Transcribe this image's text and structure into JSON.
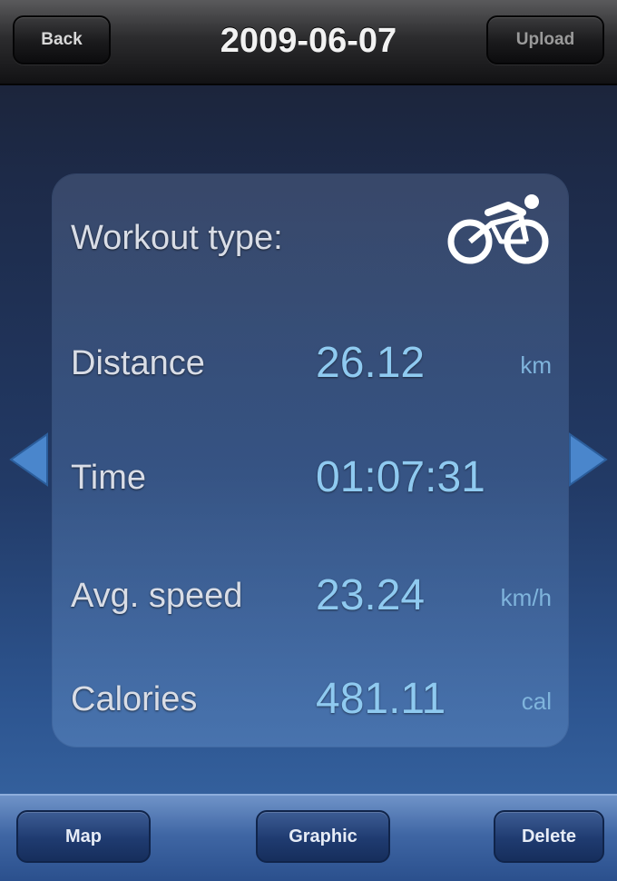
{
  "navbar": {
    "back_label": "Back",
    "title": "2009-06-07",
    "upload_label": "Upload"
  },
  "workout": {
    "type_label": "Workout type:",
    "type_icon": "bicycle-icon",
    "stats": [
      {
        "label": "Distance",
        "value": "26.12",
        "unit": "km"
      },
      {
        "label": "Time",
        "value": "01:07:31",
        "unit": ""
      },
      {
        "label": "Avg. speed",
        "value": "23.24",
        "unit": "km/h"
      },
      {
        "label": "Calories",
        "value": "481.11",
        "unit": "cal"
      }
    ]
  },
  "toolbar": {
    "map_label": "Map",
    "graphic_label": "Graphic",
    "delete_label": "Delete"
  },
  "colors": {
    "value_text": "#8fcaf0",
    "label_text": "#d9dde6",
    "arrow": "#4a86cc",
    "bike_icon": "#ffffff"
  }
}
